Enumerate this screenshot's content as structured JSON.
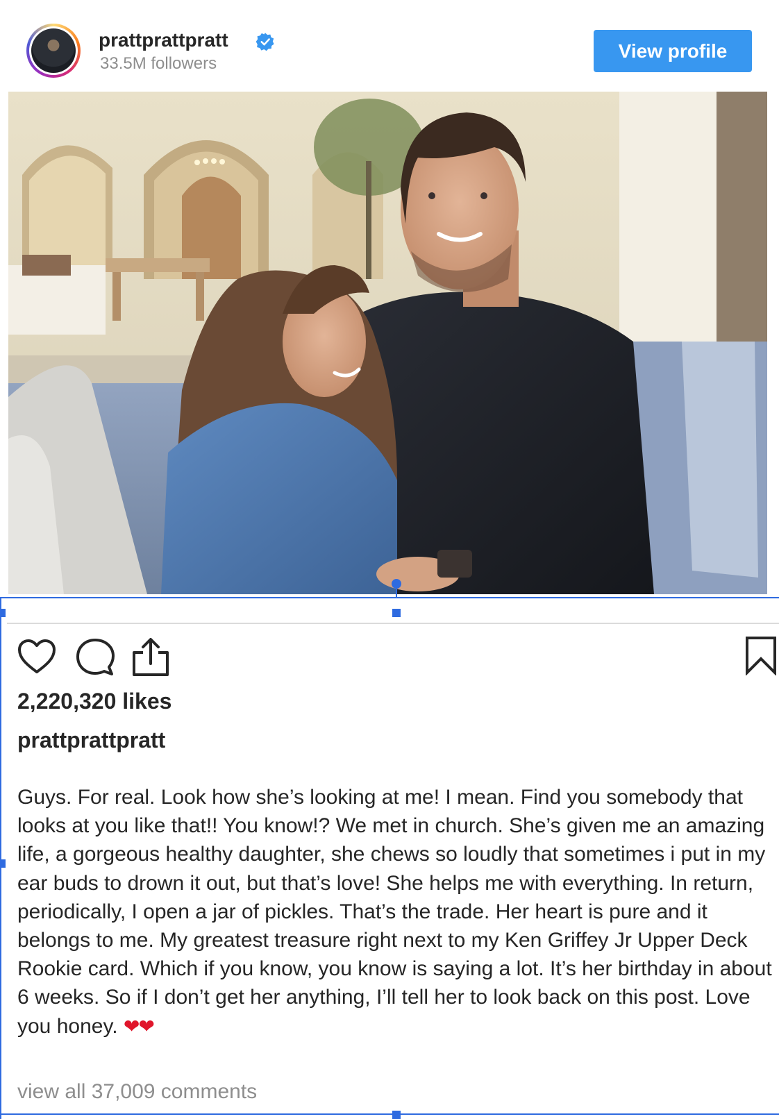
{
  "profile": {
    "username": "prattprattpratt",
    "followers": "33.5M followers",
    "view_profile_label": "View profile",
    "verified_color": "#3897f0"
  },
  "post": {
    "likes": "2,220,320 likes",
    "caption_username": "prattprattpratt",
    "caption_text": "Guys. For real. Look how she’s looking at me! I mean. Find you somebody that looks at you like that!! You know!? We met in church. She’s given me an amazing life, a gorgeous healthy daughter, she chews so loudly that sometimes i put in my ear buds to drown it out, but that’s love! She helps me with everything. In return, periodically, I open a jar of pickles. That’s the trade. Her heart is pure and it belongs to me. My greatest treasure right next to my Ken Griffey Jr Upper Deck Rookie card. Which if you know, you know is saying a lot. It’s her birthday in about 6 weeks. So if I don’t get her anything, I’ll tell her to look back on this post. Love you honey.",
    "caption_emoji": "❤❤",
    "view_comments": "view all 37,009 comments"
  },
  "icons": {
    "like": "heart-icon",
    "comment": "comment-bubble-icon",
    "share": "share-icon",
    "save": "bookmark-icon",
    "verified": "verified-badge-icon"
  },
  "colors": {
    "accent": "#3897f0",
    "selection": "#2f6be0",
    "heart_emoji": "#e0162b"
  }
}
